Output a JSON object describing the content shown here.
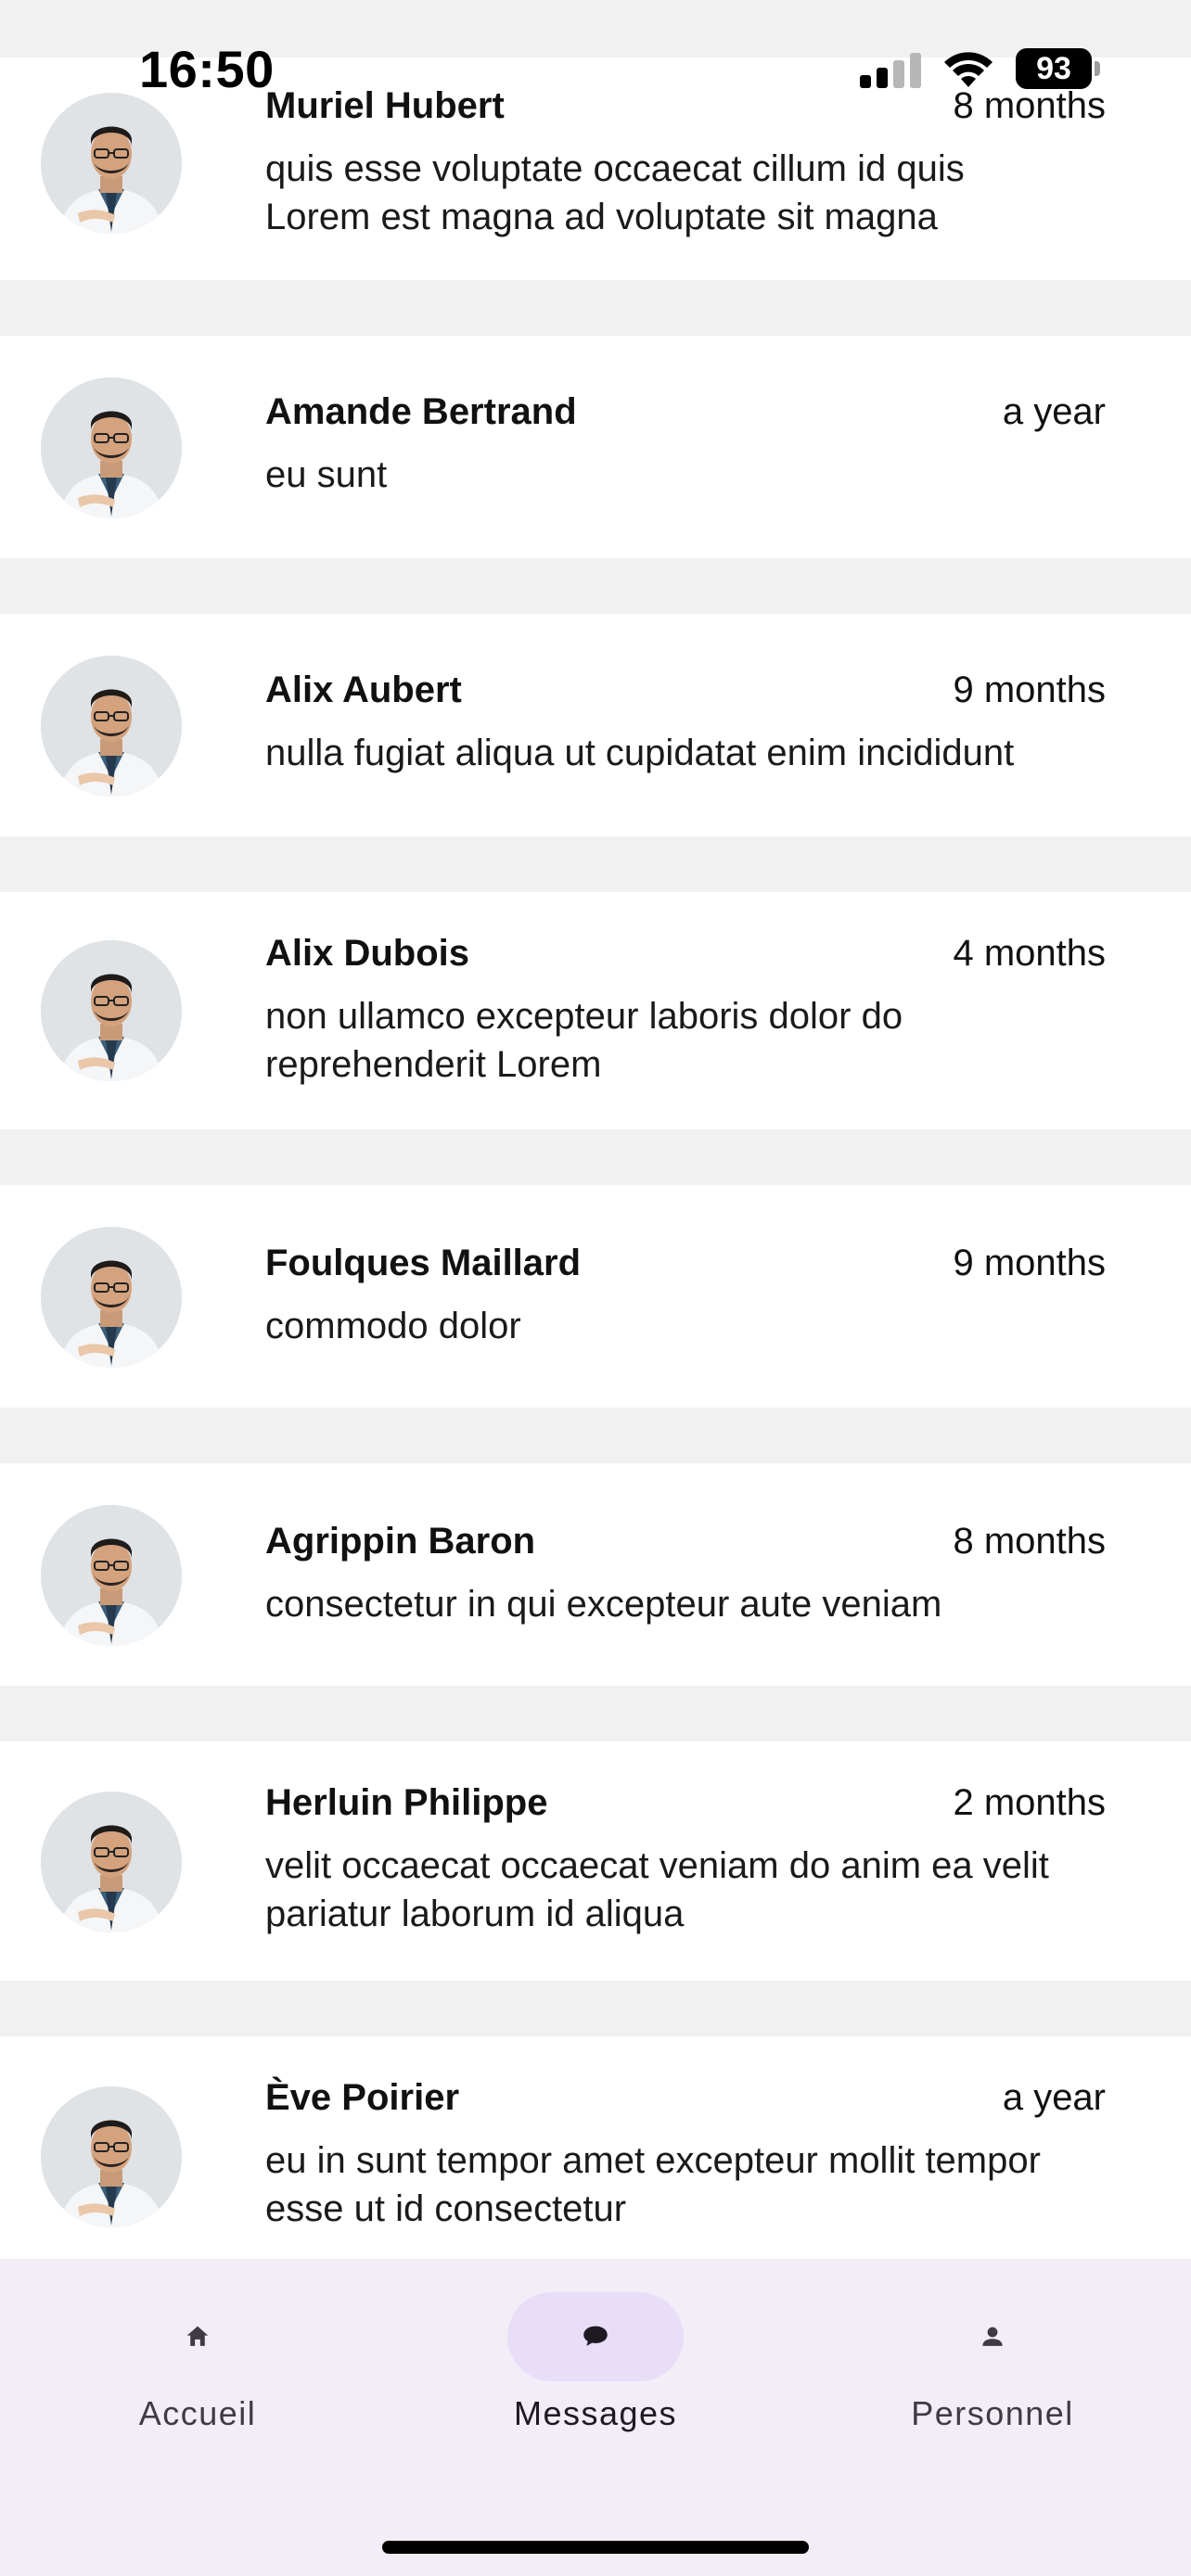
{
  "status_bar": {
    "time": "16:50",
    "battery": "93"
  },
  "messages": [
    {
      "name": "Muriel Hubert",
      "time": "8 months",
      "text": "quis esse voluptate occaecat cillum id quis Lorem est magna ad voluptate sit magna"
    },
    {
      "name": "Amande Bertrand",
      "time": "a year",
      "text": "eu sunt"
    },
    {
      "name": "Alix Aubert",
      "time": "9 months",
      "text": "nulla fugiat aliqua ut cupidatat enim incididunt"
    },
    {
      "name": "Alix Dubois",
      "time": "4 months",
      "text": "non ullamco excepteur laboris dolor do reprehenderit Lorem"
    },
    {
      "name": "Foulques Maillard",
      "time": "9 months",
      "text": "commodo dolor"
    },
    {
      "name": "Agrippin Baron",
      "time": "8 months",
      "text": "consectetur in qui excepteur aute veniam"
    },
    {
      "name": "Herluin Philippe",
      "time": "2 months",
      "text": "velit occaecat occaecat veniam do anim ea velit pariatur laborum id aliqua"
    },
    {
      "name": "Ève Poirier",
      "time": "a year",
      "text": "eu in sunt tempor amet excepteur mollit tempor esse ut id consectetur"
    }
  ],
  "bottom_nav": [
    {
      "label": "Accueil",
      "icon": "home-icon",
      "active": false
    },
    {
      "label": "Messages",
      "icon": "chat-bubble-icon",
      "active": true
    },
    {
      "label": "Personnel",
      "icon": "person-icon",
      "active": false
    }
  ],
  "colors": {
    "nav_background": "#f3edf7",
    "nav_active_pill": "#e8def8",
    "list_separator": "#f1f1f1"
  }
}
